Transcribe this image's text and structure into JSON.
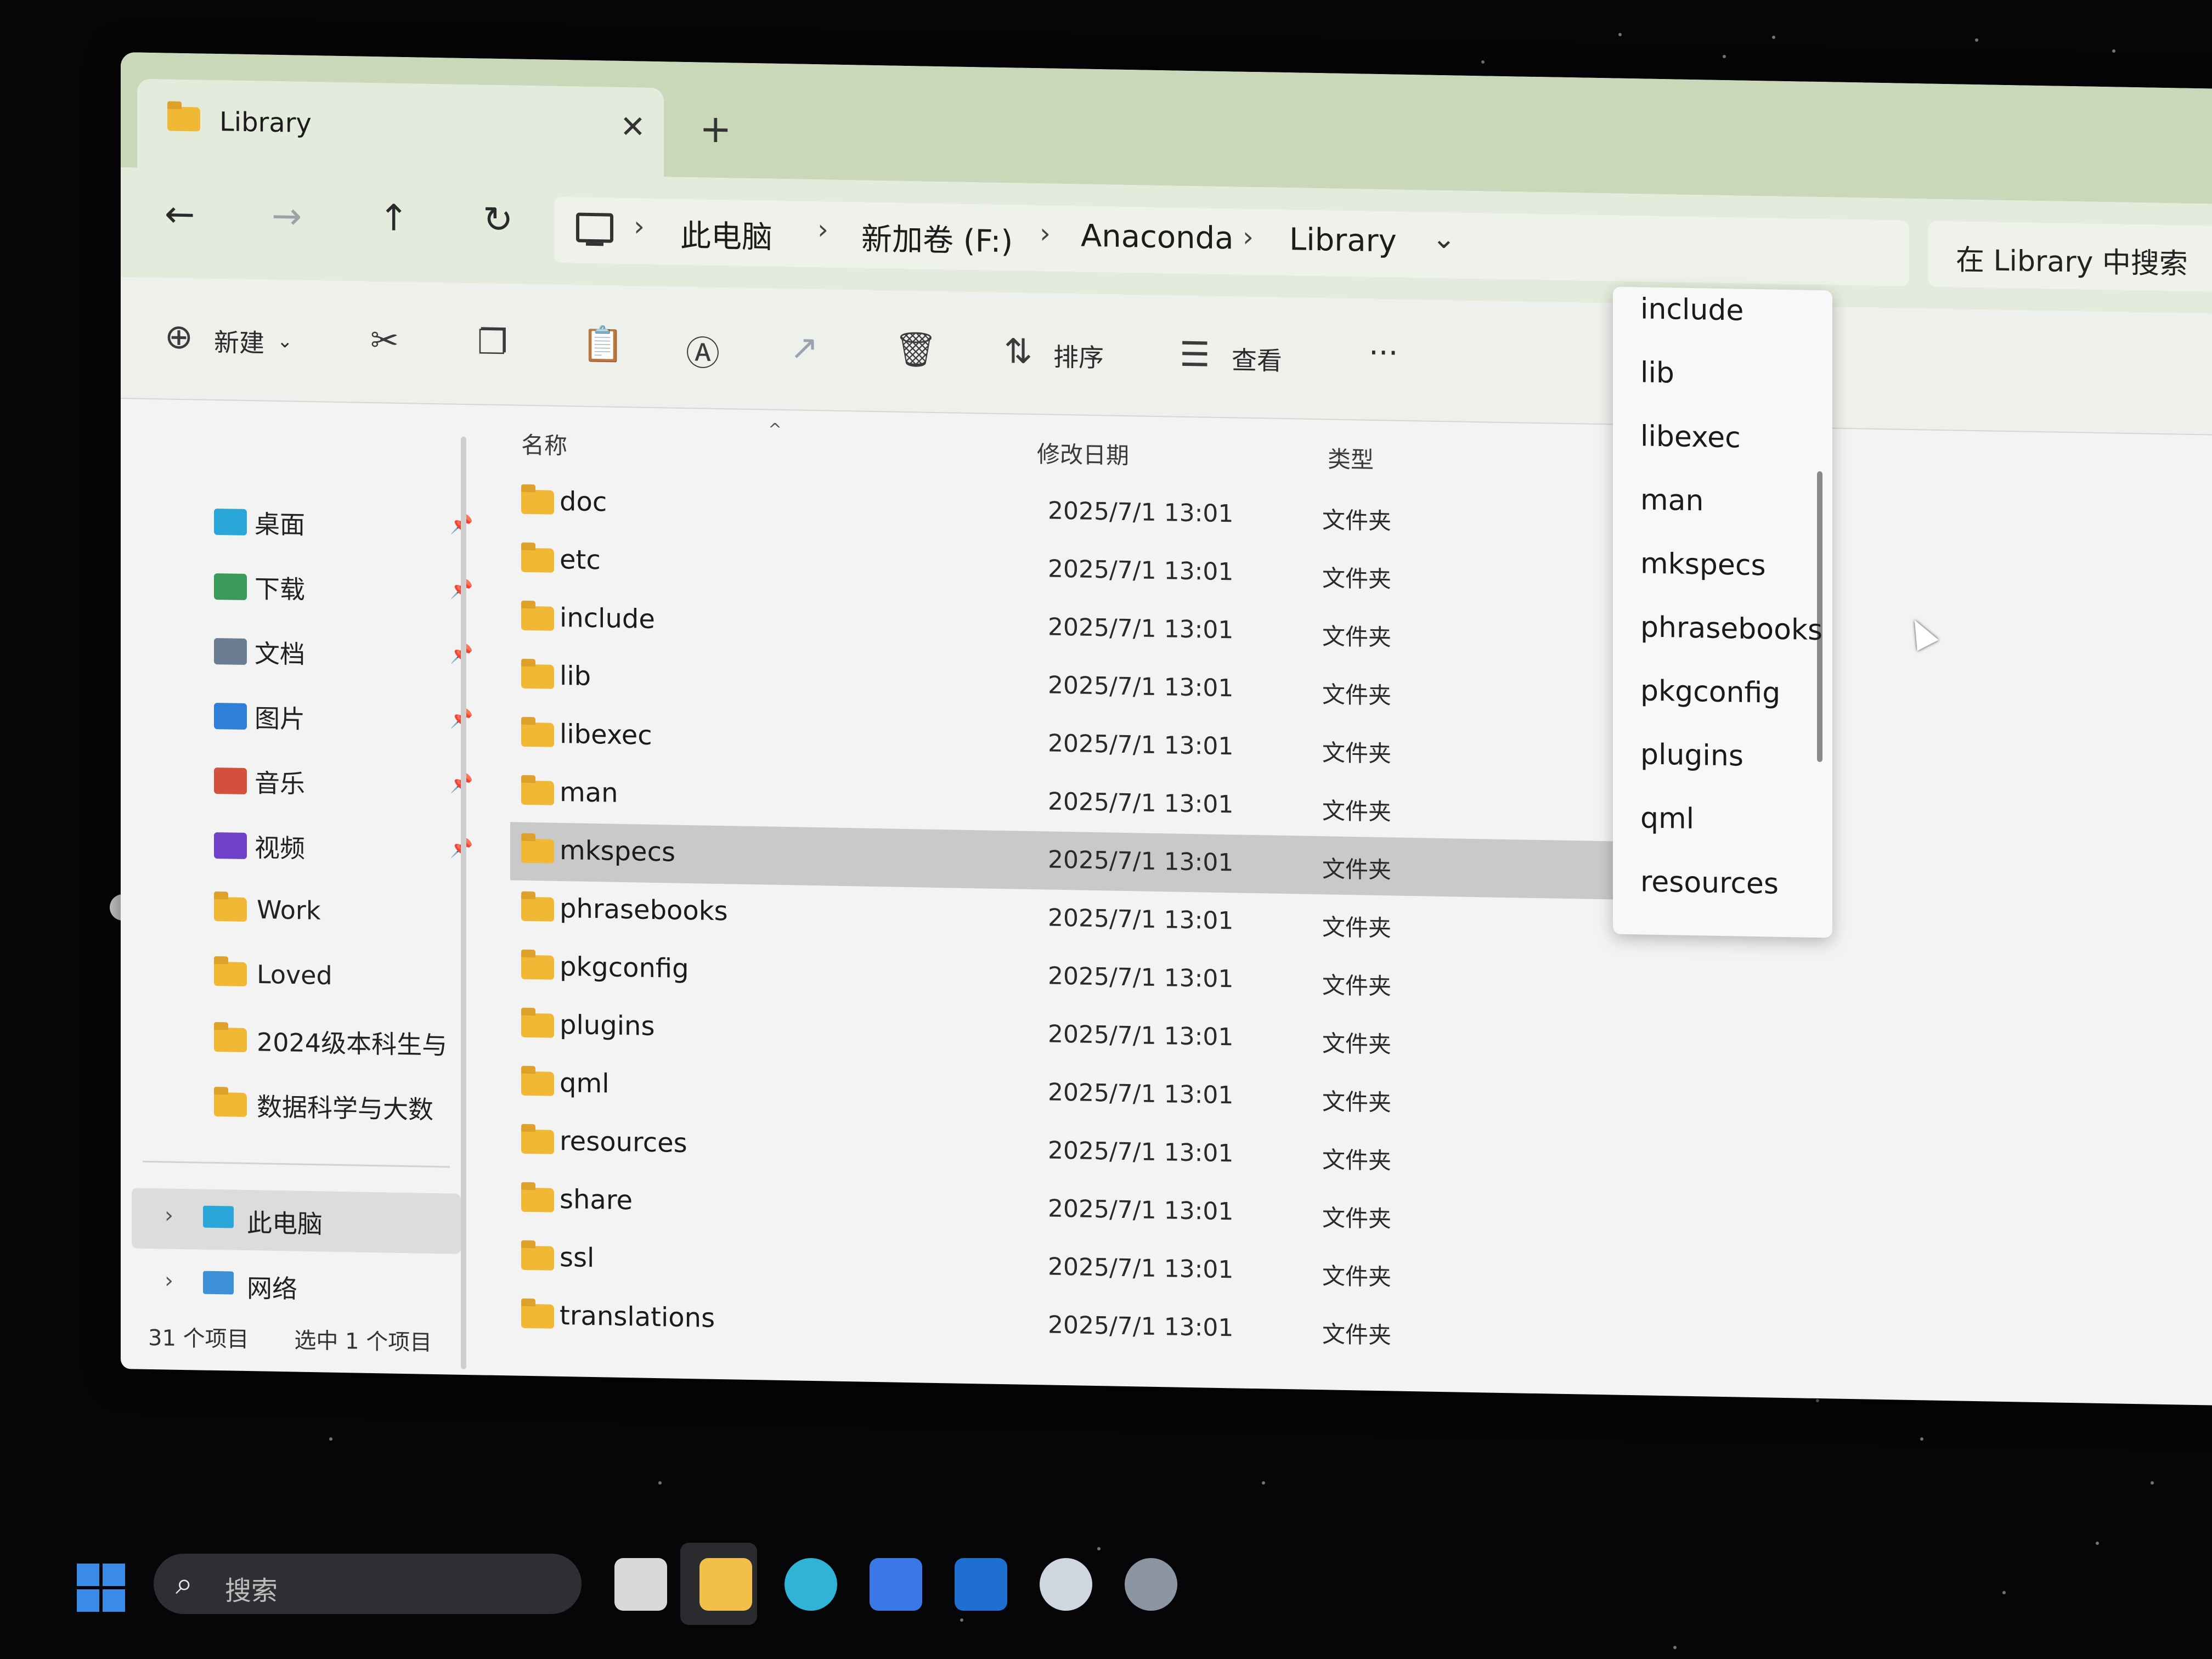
{
  "window": {
    "tab_title": "Library",
    "new_tab_label": "+",
    "close_label": "✕"
  },
  "nav": {
    "back": "←",
    "forward": "→",
    "up": "↑",
    "refresh": "↻"
  },
  "breadcrumb": {
    "items": [
      "此电脑",
      "新加卷 (F:)",
      "Anaconda",
      "Library"
    ],
    "separator": "›",
    "dropdown_glyph": "⌄"
  },
  "search": {
    "placeholder": "在 Library 中搜索"
  },
  "toolbar": {
    "new_label": "新建",
    "sort_label": "排序",
    "view_label": "查看",
    "more_label": "···",
    "icons": [
      "cut-icon",
      "copy-icon",
      "paste-icon",
      "rename-icon",
      "share-icon",
      "delete-icon"
    ]
  },
  "sidebar": {
    "quick_access": [
      {
        "label": "桌面",
        "icon": "desktop-icon",
        "pinned": true,
        "color": "#2aa7d8"
      },
      {
        "label": "下载",
        "icon": "download-icon",
        "pinned": true,
        "color": "#3a9a5a"
      },
      {
        "label": "文档",
        "icon": "document-icon",
        "pinned": true,
        "color": "#6b7d92"
      },
      {
        "label": "图片",
        "icon": "picture-icon",
        "pinned": true,
        "color": "#2f7fd8"
      },
      {
        "label": "音乐",
        "icon": "music-icon",
        "pinned": true,
        "color": "#d4503e"
      },
      {
        "label": "视频",
        "icon": "video-icon",
        "pinned": true,
        "color": "#7040c8"
      },
      {
        "label": "Work",
        "icon": "folder-icon",
        "pinned": false
      },
      {
        "label": "Loved",
        "icon": "folder-icon",
        "pinned": false
      },
      {
        "label": "2024级本科生与",
        "icon": "folder-icon",
        "pinned": false
      },
      {
        "label": "数据科学与大数",
        "icon": "folder-icon",
        "pinned": false
      }
    ],
    "this_pc": "此电脑",
    "network": "网络"
  },
  "columns": {
    "name": "名称",
    "modified": "修改日期",
    "type": "类型"
  },
  "files": [
    {
      "name": "doc",
      "modified": "2025/7/1 13:01",
      "type": "文件夹"
    },
    {
      "name": "etc",
      "modified": "2025/7/1 13:01",
      "type": "文件夹"
    },
    {
      "name": "include",
      "modified": "2025/7/1 13:01",
      "type": "文件夹"
    },
    {
      "name": "lib",
      "modified": "2025/7/1 13:01",
      "type": "文件夹"
    },
    {
      "name": "libexec",
      "modified": "2025/7/1 13:01",
      "type": "文件夹"
    },
    {
      "name": "man",
      "modified": "2025/7/1 13:01",
      "type": "文件夹"
    },
    {
      "name": "mkspecs",
      "modified": "2025/7/1 13:01",
      "type": "文件夹",
      "selected": true
    },
    {
      "name": "phrasebooks",
      "modified": "2025/7/1 13:01",
      "type": "文件夹"
    },
    {
      "name": "pkgconfig",
      "modified": "2025/7/1 13:01",
      "type": "文件夹"
    },
    {
      "name": "plugins",
      "modified": "2025/7/1 13:01",
      "type": "文件夹"
    },
    {
      "name": "qml",
      "modified": "2025/7/1 13:01",
      "type": "文件夹"
    },
    {
      "name": "resources",
      "modified": "2025/7/1 13:01",
      "type": "文件夹"
    },
    {
      "name": "share",
      "modified": "2025/7/1 13:01",
      "type": "文件夹"
    },
    {
      "name": "ssl",
      "modified": "2025/7/1 13:01",
      "type": "文件夹"
    },
    {
      "name": "translations",
      "modified": "2025/7/1 13:01",
      "type": "文件夹"
    }
  ],
  "dropdown": {
    "items": [
      "include",
      "lib",
      "libexec",
      "man",
      "mkspecs",
      "phrasebooks",
      "pkgconfig",
      "plugins",
      "qml",
      "resources"
    ]
  },
  "status": {
    "count": "31 个项目",
    "selected": "选中 1 个项目"
  },
  "taskbar": {
    "search_placeholder": "搜索",
    "apps": [
      {
        "icon": "task-view-icon",
        "color": "#d8d8d8"
      },
      {
        "icon": "file-explorer-icon",
        "color": "#f2c04a",
        "active": true
      },
      {
        "icon": "edge-icon",
        "color": "#2fb3d6"
      },
      {
        "icon": "store-icon",
        "color": "#3b78e7"
      },
      {
        "icon": "outlook-icon",
        "color": "#1e6fd0"
      },
      {
        "icon": "steam-icon",
        "color": "#cfd6e0"
      },
      {
        "icon": "settings-icon",
        "color": "#8c96a3"
      }
    ]
  },
  "colors": {
    "accent_titlebar": "#c9d8b9",
    "selection": "#c9c9c9",
    "folder": "#f1b836"
  }
}
